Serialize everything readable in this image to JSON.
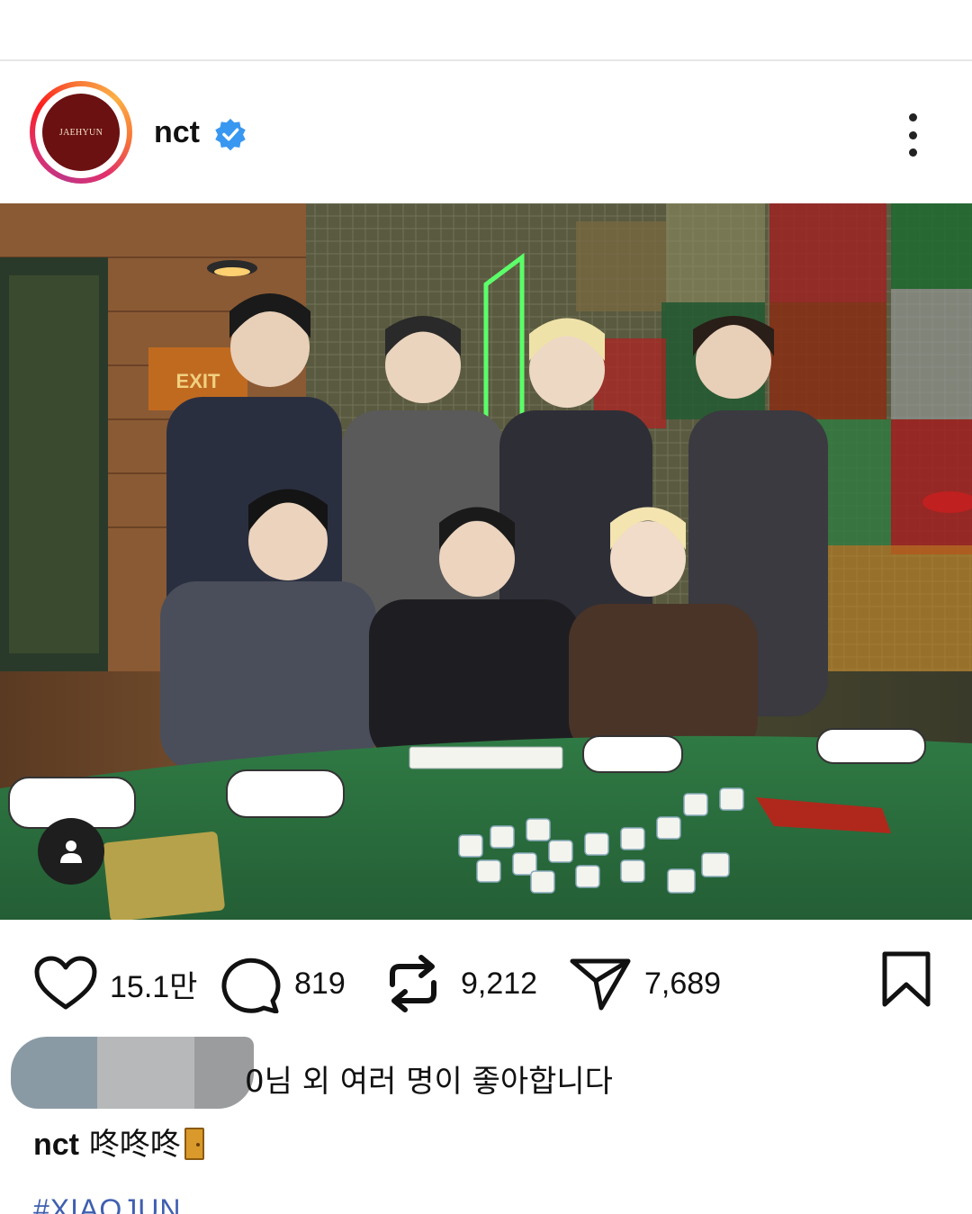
{
  "post": {
    "avatar_text": "JAEHYUN",
    "username": "nct",
    "verified": true
  },
  "photo": {
    "alt": "NCT group photo at a mahjong table",
    "person_tag_icon": "person-icon"
  },
  "actions": {
    "likes_count": "15.1만",
    "comments_count": "819",
    "reposts_count": "9,212",
    "shares_count": "7,689"
  },
  "likes": {
    "text": "0님 외 여러 명이 좋아합니다"
  },
  "caption": {
    "username": "nct",
    "text": "咚咚咚"
  },
  "hashtag": "#XIAOJUN",
  "colors": {
    "verified_blue": "#3897f0",
    "hashtag_blue": "#3f5fb0",
    "table_green": "#2f7a44"
  }
}
